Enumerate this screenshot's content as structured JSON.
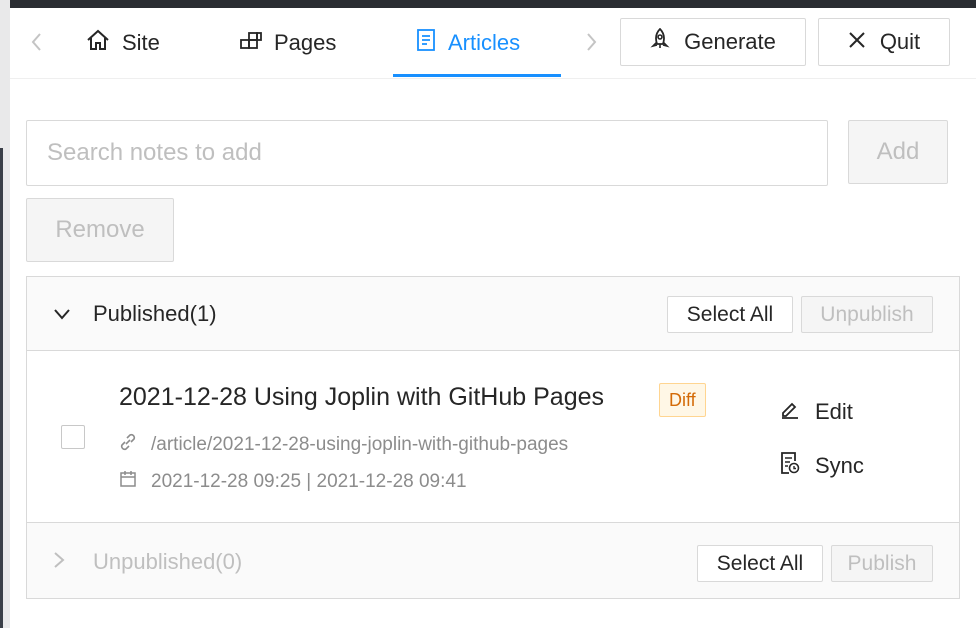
{
  "tabs": [
    {
      "label": "Site",
      "icon": "home-icon"
    },
    {
      "label": "Pages",
      "icon": "pages-icon"
    },
    {
      "label": "Articles",
      "icon": "articles-icon",
      "active": true
    }
  ],
  "header_buttons": {
    "generate": "Generate",
    "quit": "Quit"
  },
  "search": {
    "placeholder": "Search notes to add",
    "value": ""
  },
  "buttons": {
    "add": "Add",
    "remove": "Remove"
  },
  "published": {
    "title": "Published(1)",
    "select_all": "Select All",
    "unpublish": "Unpublish",
    "items": [
      {
        "title": "2021-12-28 Using Joplin with GitHub Pages",
        "tag": "Diff",
        "path": "/article/2021-12-28-using-joplin-with-github-pages",
        "dates": "2021-12-28 09:25 | 2021-12-28 09:41",
        "edit": "Edit",
        "sync": "Sync"
      }
    ]
  },
  "unpublished": {
    "title": "Unpublished(0)",
    "select_all": "Select All",
    "publish": "Publish"
  },
  "colors": {
    "accent": "#1890ff",
    "diff_tag": "#d46b08"
  }
}
